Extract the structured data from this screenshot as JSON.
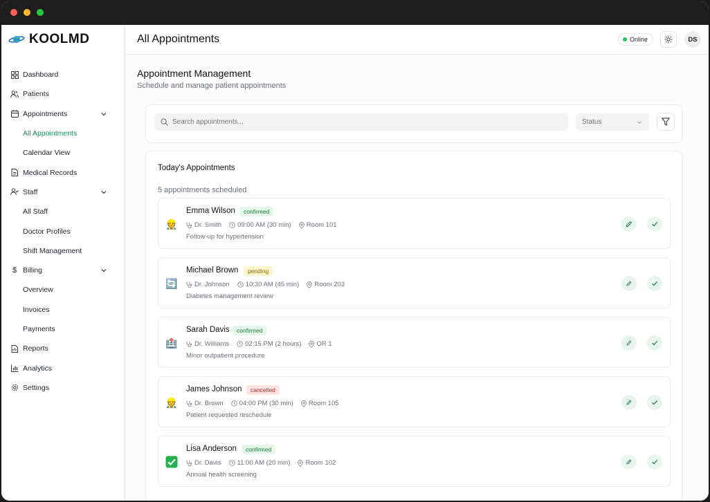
{
  "app": {
    "brand": "KOOLMD"
  },
  "sidebar": {
    "items": [
      {
        "label": "Dashboard",
        "icon": "grid-icon"
      },
      {
        "label": "Patients",
        "icon": "users-icon"
      },
      {
        "label": "Appointments",
        "icon": "calendar-icon",
        "expanded": true
      },
      {
        "label": "All Appointments",
        "sub": true,
        "active": true
      },
      {
        "label": "Calendar View",
        "sub": true
      },
      {
        "label": "Medical Records",
        "icon": "file-icon"
      },
      {
        "label": "Staff",
        "icon": "user-check-icon",
        "expanded": true
      },
      {
        "label": "All Staff",
        "sub": true
      },
      {
        "label": "Doctor Profiles",
        "sub": true
      },
      {
        "label": "Shift Management",
        "sub": true
      },
      {
        "label": "Billing",
        "icon": "dollar-icon",
        "expanded": true
      },
      {
        "label": "Overview",
        "sub": true
      },
      {
        "label": "Invoices",
        "sub": true
      },
      {
        "label": "Payments",
        "sub": true
      },
      {
        "label": "Reports",
        "icon": "report-icon"
      },
      {
        "label": "Analytics",
        "icon": "bar-chart-icon"
      },
      {
        "label": "Settings",
        "icon": "gear-icon"
      }
    ]
  },
  "header": {
    "title": "All Appointments",
    "status": "Online",
    "avatar": "DS"
  },
  "main": {
    "title": "Appointment Management",
    "subtitle": "Schedule and manage patient appointments",
    "search_placeholder": "Search appointments...",
    "status_label": "Status",
    "list_title": "Today's Appointments",
    "list_count": "5 appointments scheduled"
  },
  "colors": {
    "accent": "#17905a",
    "confirmed": "#177a3a",
    "pending": "#8a6a00",
    "cancelled": "#b42323"
  },
  "appointments": [
    {
      "name": "Emma Wilson",
      "status": "confirmed",
      "doctor": "Dr. Smith",
      "time": "09:00 AM (30 min)",
      "room": "Room 101",
      "note": "Follow-up for hypertension",
      "icon": "doctor-emoji-icon"
    },
    {
      "name": "Michael Brown",
      "status": "pending",
      "doctor": "Dr. Johnson",
      "time": "10:30 AM (45 min)",
      "room": "Room 203",
      "note": "Diabetes management review",
      "icon": "refresh-emoji-icon"
    },
    {
      "name": "Sarah Davis",
      "status": "confirmed",
      "doctor": "Dr. Williams",
      "time": "02:15 PM (2 hours)",
      "room": "OR 1",
      "note": "Minor outpatient procedure",
      "icon": "hospital-emoji-icon"
    },
    {
      "name": "James Johnson",
      "status": "cancelled",
      "doctor": "Dr. Brown",
      "time": "04:00 PM (30 min)",
      "room": "Room 105",
      "note": "Patient requested reschedule",
      "icon": "doctor-emoji-icon"
    },
    {
      "name": "Lisa Anderson",
      "status": "confirmed",
      "doctor": "Dr. Davis",
      "time": "11:00 AM (20 min)",
      "room": "Room 102",
      "note": "Annual health screening",
      "icon": "check-emoji-icon"
    }
  ]
}
